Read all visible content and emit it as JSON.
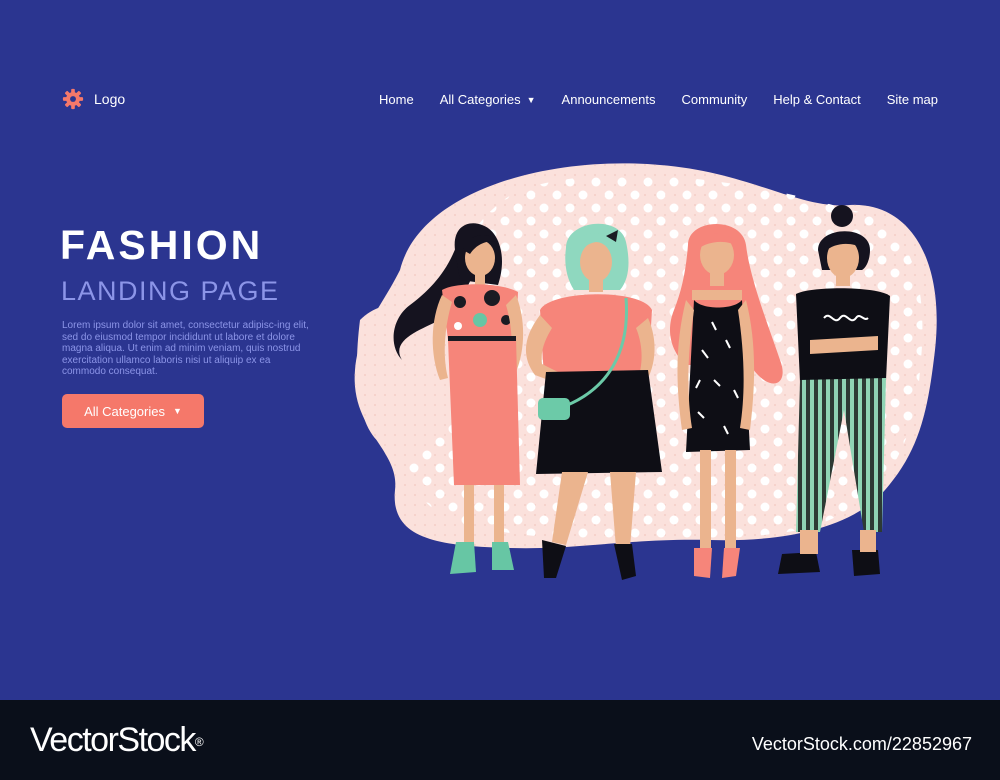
{
  "header": {
    "logo_label": "Logo",
    "nav": {
      "home": "Home",
      "all_categories": "All Categories",
      "announcements": "Announcements",
      "community": "Community",
      "help_contact": "Help & Contact",
      "site_map": "Site map"
    }
  },
  "hero": {
    "title": "FASHION",
    "subtitle": "LANDING PAGE",
    "body": "Lorem ipsum dolor sit amet, consectetur adipisc-ing elit, sed do eiusmod tempor incididunt ut labore et dolore magna aliqua. Ut enim ad minim veniam, quis nostrud exercitation ullamco laboris nisi ut aliquip ex ea commodo consequat.",
    "cta_label": "All Categories"
  },
  "footer": {
    "brand": "VectorStock",
    "brand_mark": "®",
    "image_id": "VectorStock.com/22852967"
  },
  "icons": {
    "logo": "gear-icon",
    "dropdown": "caret-down-icon"
  },
  "colors": {
    "background": "#2b3590",
    "accent": "#f5786a",
    "blob": "#fbe1dc",
    "muted_text": "#8c95e8",
    "footer": "#0a0f1a"
  }
}
